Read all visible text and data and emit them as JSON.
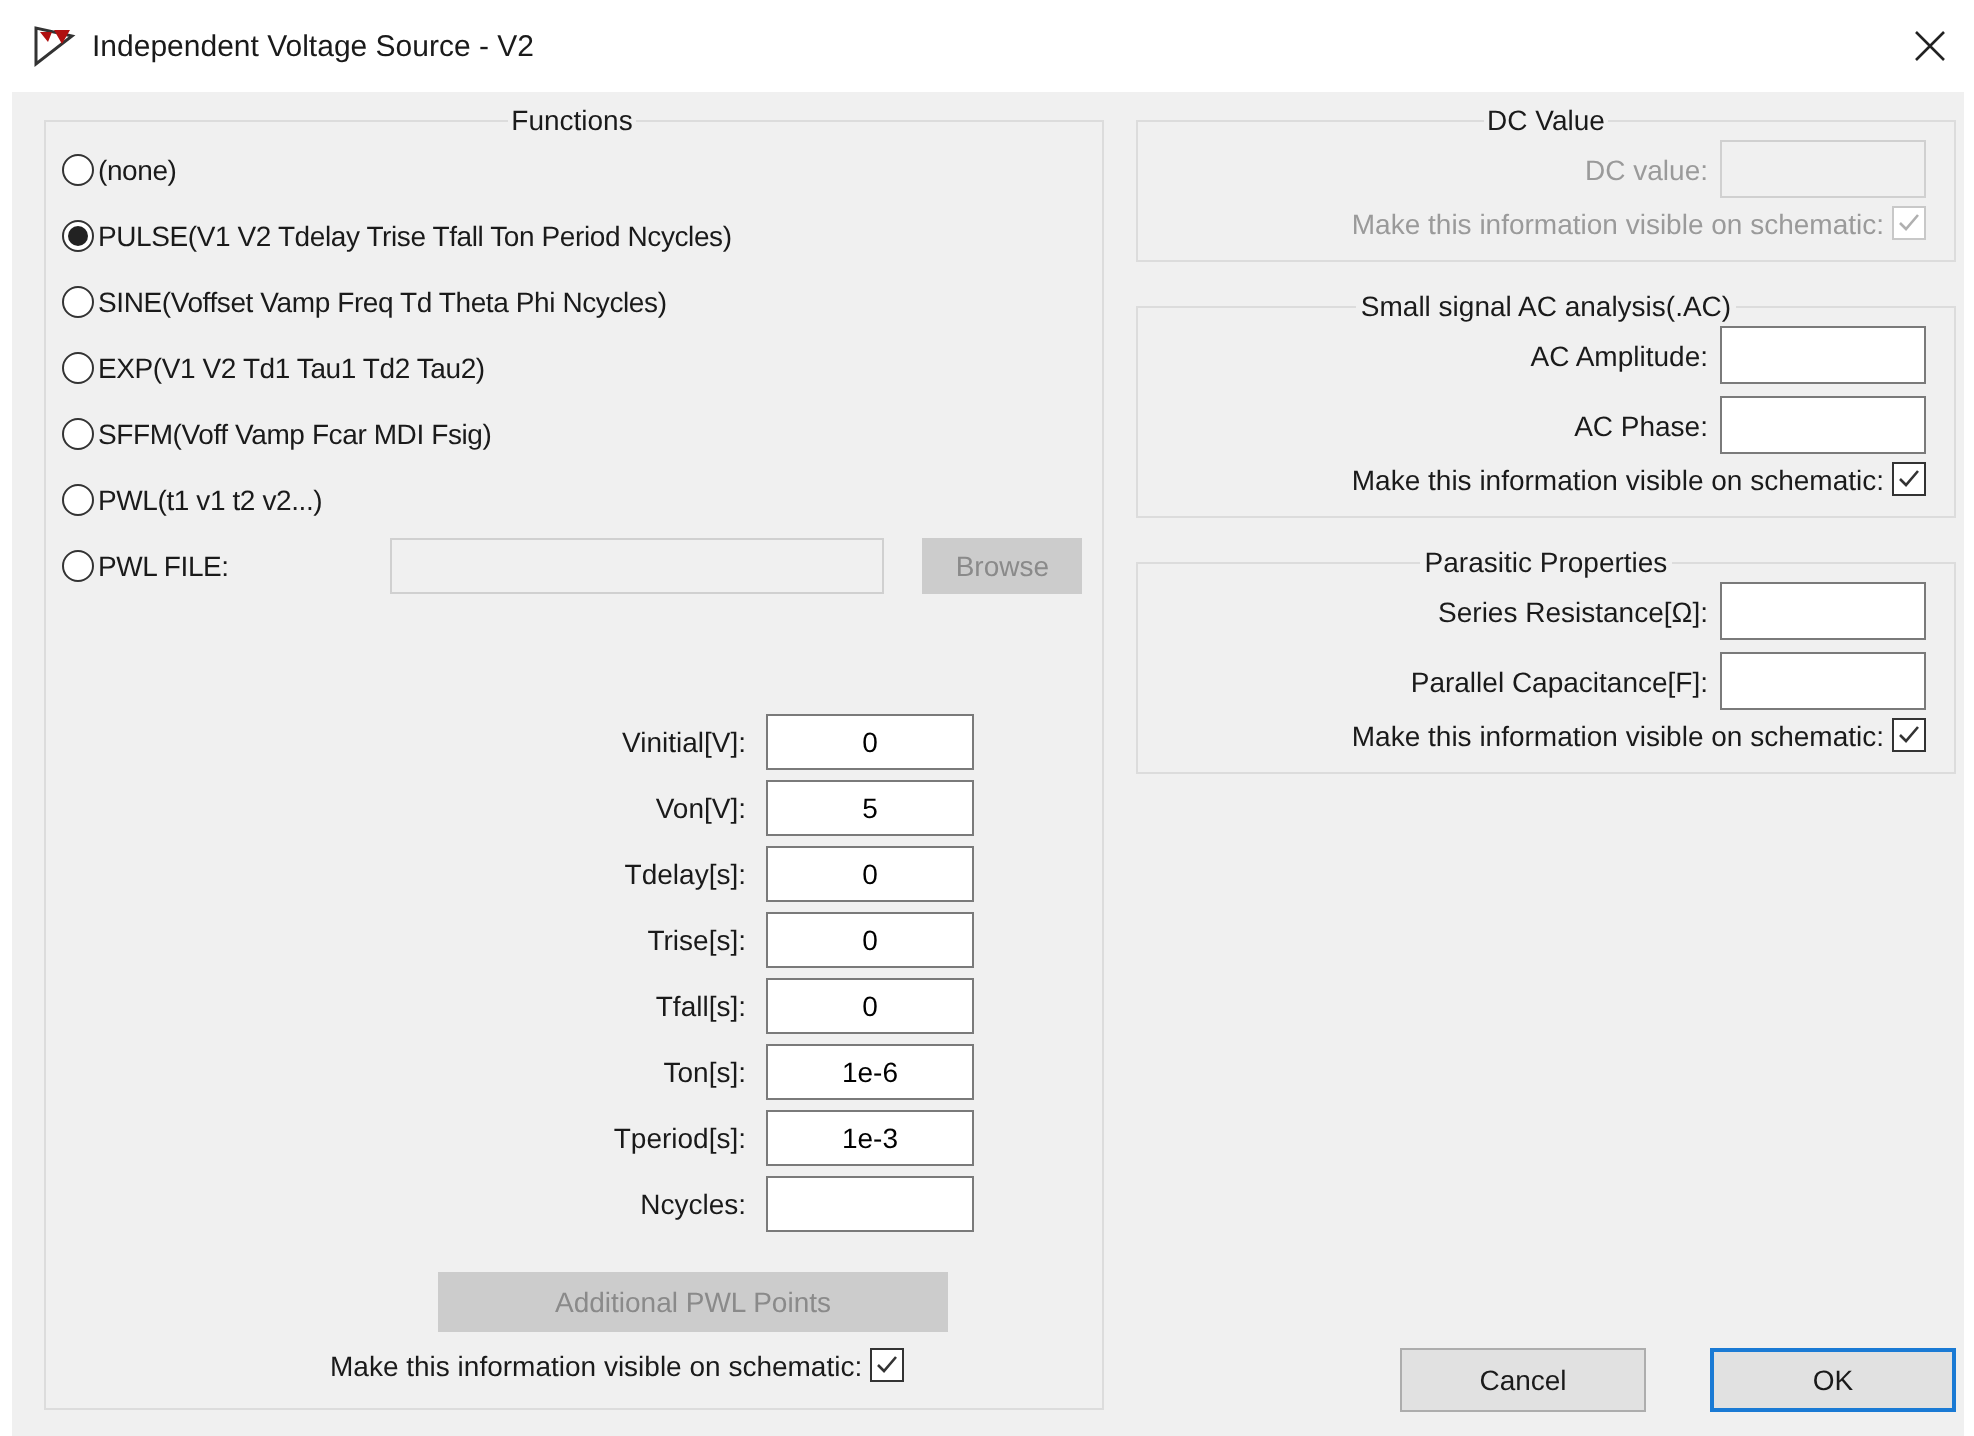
{
  "window": {
    "title": "Independent Voltage Source - V2"
  },
  "functions": {
    "title": "Functions",
    "options": [
      {
        "kind": "plain",
        "label": "(none)",
        "selected": false
      },
      {
        "kind": "plain",
        "label": "PULSE(V1 V2 Tdelay Trise Tfall Ton Period Ncycles)",
        "selected": true
      },
      {
        "kind": "plain",
        "label": "SINE(Voffset Vamp Freq Td Theta Phi Ncycles)",
        "selected": false
      },
      {
        "kind": "plain",
        "label": "EXP(V1 V2 Td1 Tau1 Td2 Tau2)",
        "selected": false
      },
      {
        "kind": "plain",
        "label": "SFFM(Voff Vamp Fcar MDI Fsig)",
        "selected": false
      },
      {
        "kind": "plain",
        "label": "PWL(t1 v1 t2 v2...)",
        "selected": false
      },
      {
        "kind": "file",
        "label": "PWL FILE:",
        "selected": false,
        "field_disabled": true,
        "browse": {
          "label": "Browse",
          "disabled": true
        }
      }
    ],
    "parameters": [
      {
        "label": "Vinitial[V]:",
        "value": "0"
      },
      {
        "label": "Von[V]:",
        "value": "5"
      },
      {
        "label": "Tdelay[s]:",
        "value": "0"
      },
      {
        "label": "Trise[s]:",
        "value": "0"
      },
      {
        "label": "Tfall[s]:",
        "value": "0"
      },
      {
        "label": "Ton[s]:",
        "value": "1e-6"
      },
      {
        "label": "Tperiod[s]:",
        "value": "1e-3"
      },
      {
        "label": "Ncycles:"
      }
    ],
    "additional_button": {
      "label": "Additional PWL Points",
      "disabled": true
    },
    "visible": {
      "label": "Make this information visible on schematic:",
      "checked": true,
      "disabled": false
    }
  },
  "groups": [
    {
      "title": "DC Value",
      "fields": [
        {
          "label": "DC value:",
          "disabled": true
        }
      ],
      "visible": {
        "label": "Make this information visible on schematic:",
        "checked": true,
        "disabled": true
      }
    },
    {
      "title": "Small signal AC analysis(.AC)",
      "fields": [
        {
          "label": "AC Amplitude:",
          "disabled": false
        },
        {
          "label": "AC Phase:",
          "disabled": false
        }
      ],
      "visible": {
        "label": "Make this information visible on schematic:",
        "checked": true,
        "disabled": false
      }
    },
    {
      "title": "Parasitic Properties",
      "fields": [
        {
          "label": "Series Resistance[Ω]:",
          "disabled": false
        },
        {
          "label": "Parallel Capacitance[F]:",
          "disabled": false
        }
      ],
      "visible": {
        "label": "Make this information visible on schematic:",
        "checked": true,
        "disabled": false
      }
    }
  ],
  "buttons": [
    {
      "label": "Cancel",
      "default": false
    },
    {
      "label": "OK",
      "default": true
    }
  ]
}
